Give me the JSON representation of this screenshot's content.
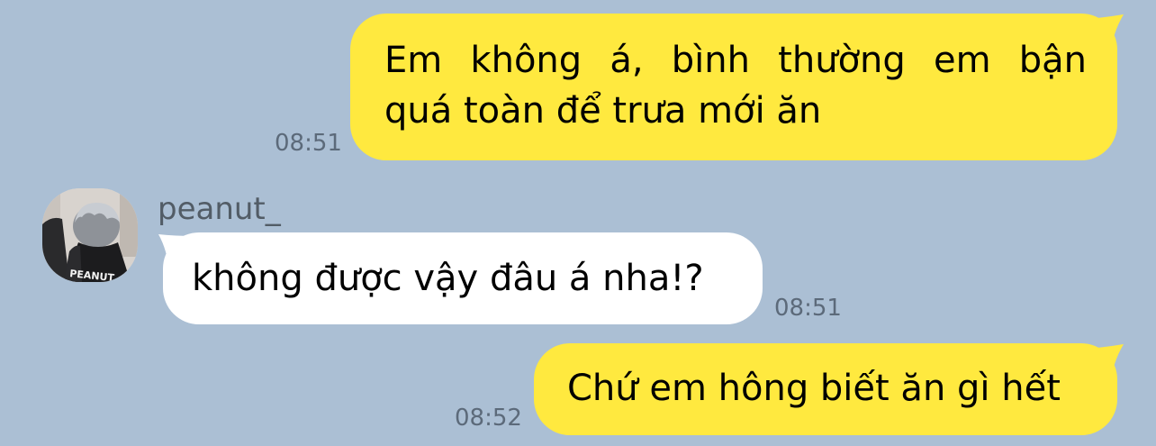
{
  "messages": [
    {
      "direction": "outgoing",
      "lines": [
        "Em không á, bình thường em bận",
        "quá toàn để trưa mới ăn"
      ],
      "time": "08:51"
    },
    {
      "direction": "incoming",
      "sender": "peanut_",
      "text": "không được vậy đâu á nha!?",
      "time": "08:51"
    },
    {
      "direction": "outgoing",
      "text": "Chứ em hông biết ăn gì hết",
      "time": "08:52"
    }
  ],
  "avatar": {
    "icon": "user-avatar-photo",
    "shirt_print": "PEANUT"
  },
  "colors": {
    "background": "#abbfd4",
    "outgoing_bubble": "#ffe93f",
    "incoming_bubble": "#ffffff",
    "timestamp": "#5c6a7a",
    "sender_name": "#525c66"
  }
}
